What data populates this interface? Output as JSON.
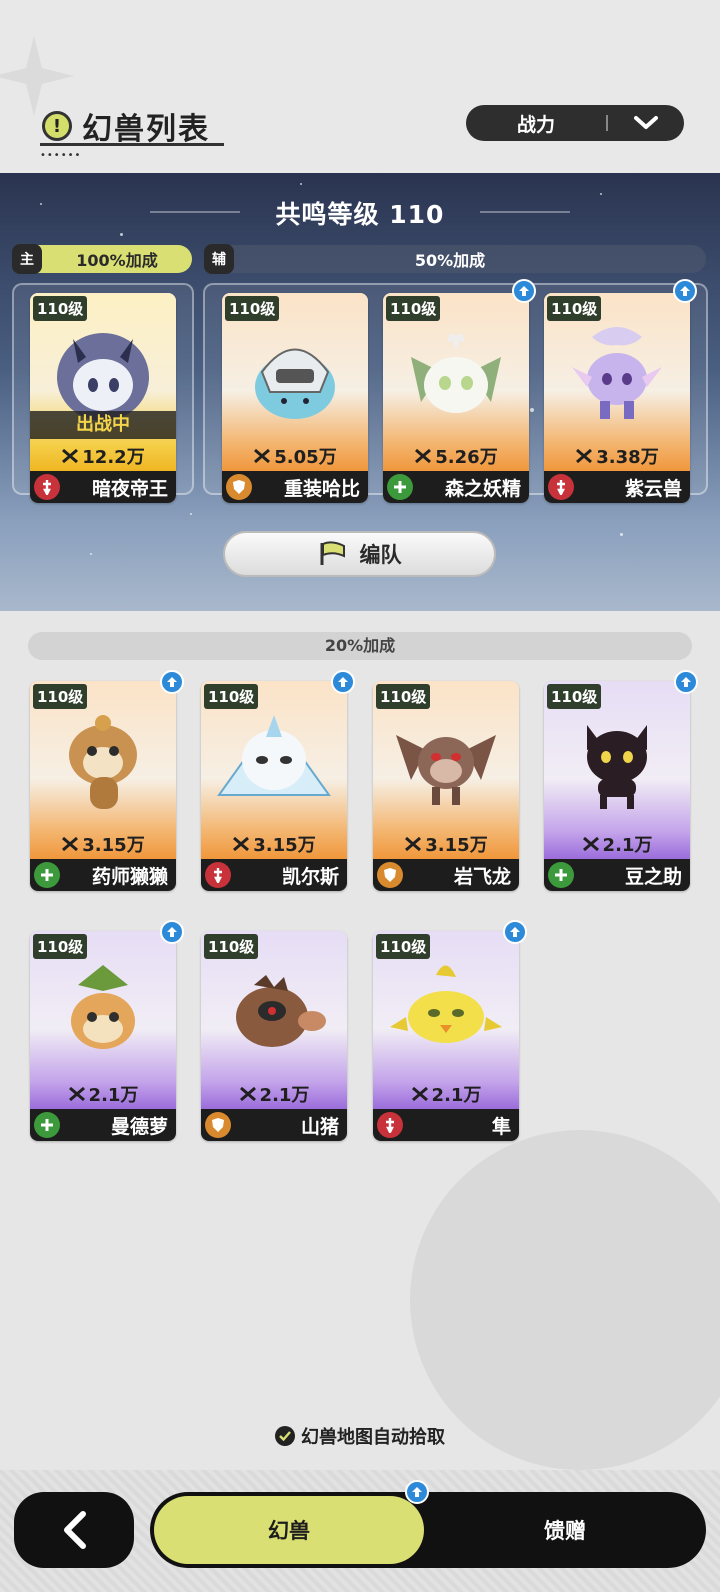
{
  "header": {
    "title": "幻兽列表",
    "sort": {
      "selected": "战力"
    }
  },
  "resonance": {
    "title": "共鸣等级 110",
    "main_tag": "主",
    "main_bonus": "100%加成",
    "sub_tag": "辅",
    "sub_bonus": "50%加成",
    "formation_button": "编队"
  },
  "main_card": {
    "level": "110级",
    "power": "12.2万",
    "name": "暗夜帝王",
    "status": "出战中",
    "role": "attack",
    "theme": "gold",
    "upgradable": false
  },
  "sub_cards": [
    {
      "level": "110级",
      "power": "5.05万",
      "name": "重装哈比",
      "role": "defense",
      "theme": "orange",
      "upgradable": false
    },
    {
      "level": "110级",
      "power": "5.26万",
      "name": "森之妖精",
      "role": "support",
      "theme": "orange",
      "upgradable": true
    },
    {
      "level": "110级",
      "power": "3.38万",
      "name": "紫云兽",
      "role": "attack",
      "theme": "orange",
      "upgradable": true
    }
  ],
  "others_bonus": "20%加成",
  "other_cards": [
    {
      "level": "110级",
      "power": "3.15万",
      "name": "药师獭獭",
      "role": "support",
      "theme": "orange",
      "upgradable": true
    },
    {
      "level": "110级",
      "power": "3.15万",
      "name": "凯尔斯",
      "role": "attack",
      "theme": "orange",
      "upgradable": true
    },
    {
      "level": "110级",
      "power": "3.15万",
      "name": "岩飞龙",
      "role": "defense",
      "theme": "orange",
      "upgradable": false
    },
    {
      "level": "110级",
      "power": "2.1万",
      "name": "豆之助",
      "role": "support",
      "theme": "purple",
      "upgradable": true
    },
    {
      "level": "110级",
      "power": "2.1万",
      "name": "曼德萝",
      "role": "support",
      "theme": "purple",
      "upgradable": true
    },
    {
      "level": "110级",
      "power": "2.1万",
      "name": "山猪",
      "role": "defense",
      "theme": "purple",
      "upgradable": false
    },
    {
      "level": "110级",
      "power": "2.1万",
      "name": "隼",
      "role": "attack",
      "theme": "purple",
      "upgradable": true
    }
  ],
  "auto_pickup": {
    "label": "幻兽地图自动拾取",
    "checked": true
  },
  "bottom_nav": {
    "tab_active": "幻兽",
    "tab_inactive": "馈赠",
    "active_has_upgrade": true
  },
  "colors": {
    "accent": "#d9df73",
    "dark": "#1d1d1d",
    "role_attack": "#c8323a",
    "role_defense": "#d98a2e",
    "role_support": "#3c9a3c",
    "upgrade": "#2c8ad8"
  }
}
